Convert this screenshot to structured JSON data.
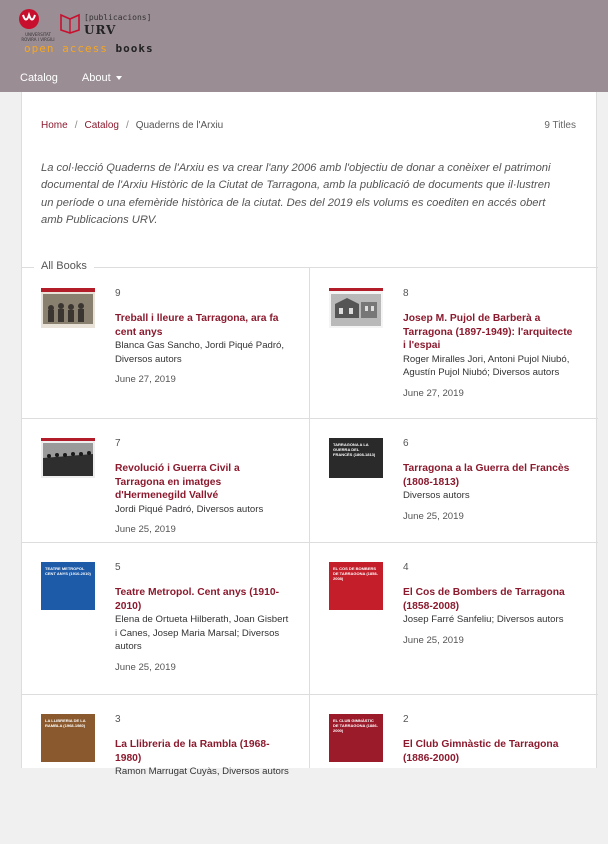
{
  "header": {
    "university_text": "UNIVERSITAT ROVIRA I VIRGILI",
    "publisher_word": "[publicacions]",
    "urv_word": "URV",
    "site_title_part1": "open access",
    "site_title_part2": "books",
    "nav": [
      {
        "label": "Catalog"
      },
      {
        "label": "About"
      }
    ],
    "colors": {
      "header_bg": "#9a8d94",
      "accent": "#8b1a2e",
      "orange": "#f5a623"
    }
  },
  "breadcrumb": {
    "home": "Home",
    "catalog": "Catalog",
    "current": "Quaderns de l'Arxiu",
    "separator": "/"
  },
  "title_count": "9 Titles",
  "description": "La col·lecció Quaderns de l'Arxiu es va crear l'any 2006 amb l'objectiu de donar a conèixer el patrimoni documental de l'Arxiu Històric de la Ciutat de Tarragona, amb la publicació de documents que il·lustren un període o una efemèride històrica de la ciutat. Des del 2019 els volums es coediten en accés obert amb Publicacions URV.",
  "section_title": "All Books",
  "books": [
    {
      "number": "9",
      "title": "Treball i lleure a Tarragona, ara fa cent anys",
      "authors": "Blanca Gas Sancho, Jordi Piqué Padró, Diversos autors",
      "date": "June 27, 2019",
      "cover_icon": "photo-cover-icon"
    },
    {
      "number": "8",
      "title": "Josep M. Pujol de Barberà a Tarragona (1897-1949): l'arquitecte i l'espai",
      "authors": "Roger Miralles Jori, Antoni Pujol Niubó, Agustín Pujol Niubó; Diversos autors",
      "date": "June 27, 2019",
      "cover_icon": "building-cover-icon"
    },
    {
      "number": "7",
      "title": "Revolució i Guerra Civil a Tarragona en imatges d'Hermenegild Vallvé",
      "authors": "Jordi Piqué Padró, Diversos autors",
      "date": "June 25, 2019",
      "cover_icon": "crowd-cover-icon"
    },
    {
      "number": "6",
      "title": "Tarragona a la Guerra del Francès (1808-1813)",
      "authors": "Diversos autors",
      "date": "June 25, 2019",
      "cover_icon": "dark-cover-icon",
      "cover_text": "TARRAGONA A LA GUERRA DEL FRANCÈS (1808-1813)"
    },
    {
      "number": "5",
      "title": "Teatre Metropol. Cent anys (1910-2010)",
      "authors": "Elena de Ortueta Hilberath, Joan Gisbert i Canes, Josep Maria Marsal; Diversos autors",
      "date": "June 25, 2019",
      "cover_icon": "blue-cover-icon",
      "cover_text": "TEATRE METROPOL CENT ANYS (1910-2010)"
    },
    {
      "number": "4",
      "title": "El Cos de Bombers de Tarragona (1858-2008)",
      "authors": "Josep Farré Sanfeliu; Diversos autors",
      "date": "June 25, 2019",
      "cover_icon": "red-cover-icon",
      "cover_text": "EL COS DE BOMBERS DE TARRAGONA (1858-2008)"
    },
    {
      "number": "3",
      "title": "La Llibreria de la Rambla (1968- 1980)",
      "authors": "Ramon Marrugat Cuyàs, Diversos autors",
      "date": "",
      "cover_icon": "brown-cover-icon",
      "cover_text": "LA LLIBRERIA DE LA RAMBLA (1968-1980)"
    },
    {
      "number": "2",
      "title": "El Club Gimnàstic de Tarragona (1886-2000)",
      "authors": "",
      "date": "",
      "cover_icon": "maroon-cover-icon",
      "cover_text": "EL CLUB GIMNÀSTIC DE TARRAGONA (1886-2000)"
    }
  ]
}
